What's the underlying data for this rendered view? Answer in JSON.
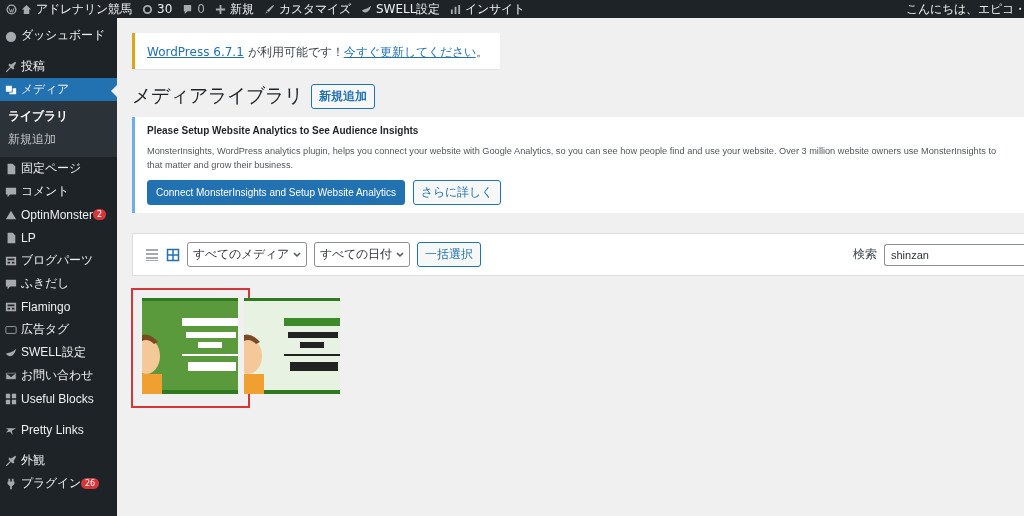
{
  "admin_bar": {
    "site": "アドレナリン競馬",
    "updates": "30",
    "comments": "0",
    "new": "新規",
    "customize": "カスタマイズ",
    "swell": "SWELL設定",
    "insight": "インサイト",
    "greeting": "こんにちは、エピコ・"
  },
  "sidebar": {
    "items": [
      {
        "label": "ダッシュボード",
        "selected": false
      },
      {
        "label": "投稿",
        "selected": false
      },
      {
        "label": "メディア",
        "selected": true,
        "children": [
          {
            "label": "ライブラリ",
            "selected": true
          },
          {
            "label": "新規追加",
            "selected": false
          }
        ]
      },
      {
        "label": "固定ページ",
        "selected": false
      },
      {
        "label": "コメント",
        "selected": false
      },
      {
        "label": "OptinMonster",
        "selected": false,
        "badge": "2"
      },
      {
        "label": "LP",
        "selected": false
      },
      {
        "label": "ブログパーツ",
        "selected": false
      },
      {
        "label": "ふきだし",
        "selected": false
      },
      {
        "label": "Flamingo",
        "selected": false
      },
      {
        "label": "広告タグ",
        "selected": false
      },
      {
        "label": "SWELL設定",
        "selected": false
      },
      {
        "label": "お問い合わせ",
        "selected": false
      },
      {
        "label": "Useful Blocks",
        "selected": false
      },
      {
        "label": "Pretty Links",
        "selected": false
      },
      {
        "label": "外観",
        "selected": false
      },
      {
        "label": "プラグイン",
        "selected": false,
        "badge": "26"
      }
    ]
  },
  "notice": {
    "link": "WordPress 6.7.1",
    "text": " が利用可能です！",
    "action": "今すぐ更新してください",
    "end": "。"
  },
  "page": {
    "title": "メディアライブラリ",
    "add_button": "新規追加"
  },
  "analytics": {
    "title": "Please Setup Website Analytics to See Audience Insights",
    "lines": [
      "MonsterInsights, WordPress analytics plugin, helps you connect your website with Google Analytics, so you can see how people find and use your website. Over 3 million website owners use MonsterInsights to",
      "that matter and grow their business."
    ],
    "primary_button": "Connect MonsterInsights and Setup Website Analytics",
    "secondary_button": "さらに詳しく"
  },
  "toolbar": {
    "views": [
      {
        "kind": "list",
        "selected": false
      },
      {
        "kind": "grid",
        "selected": true
      }
    ],
    "filters": [
      "すべてのメディア",
      "すべての日付"
    ],
    "bulk_button": "一括選択",
    "search_label": "検索",
    "search_value": "shinzan"
  },
  "media": [
    {
      "kind": "picture",
      "selected": true
    },
    {
      "kind": "picture",
      "selected": false
    }
  ]
}
